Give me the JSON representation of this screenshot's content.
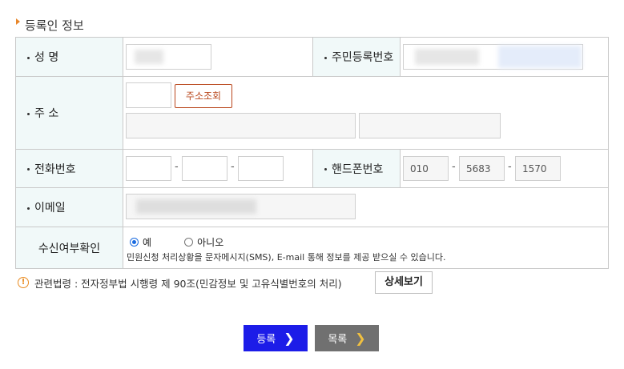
{
  "section_title": "등록인 정보",
  "fields": {
    "name_label": "성 명",
    "rrn_label": "주민등록번호",
    "address_label": "주 소",
    "address_search": "주소조회",
    "phone_label": "전화번호",
    "mobile_label": "핸드폰번호",
    "mobile_1": "010",
    "mobile_2": "5683",
    "mobile_3": "1570",
    "email_label": "이메일",
    "consent_label": "수신여부확인",
    "consent_yes": "예",
    "consent_no": "아니오",
    "consent_desc": "민원신청 처리상황을 문자메시지(SMS), E-mail 통해 정보를 제공 받으실 수 있습니다.",
    "dash": "-"
  },
  "notice": {
    "text": "관련법령 : 전자정부법 시행령 제 90조(민감정보 및 고유식별번호의 처리)",
    "detail_button": "상세보기",
    "icon": "!"
  },
  "actions": {
    "register": "등록",
    "list": "목록",
    "register_color": "#1c1ce8",
    "list_color": "#707070",
    "chevron": "❯"
  }
}
